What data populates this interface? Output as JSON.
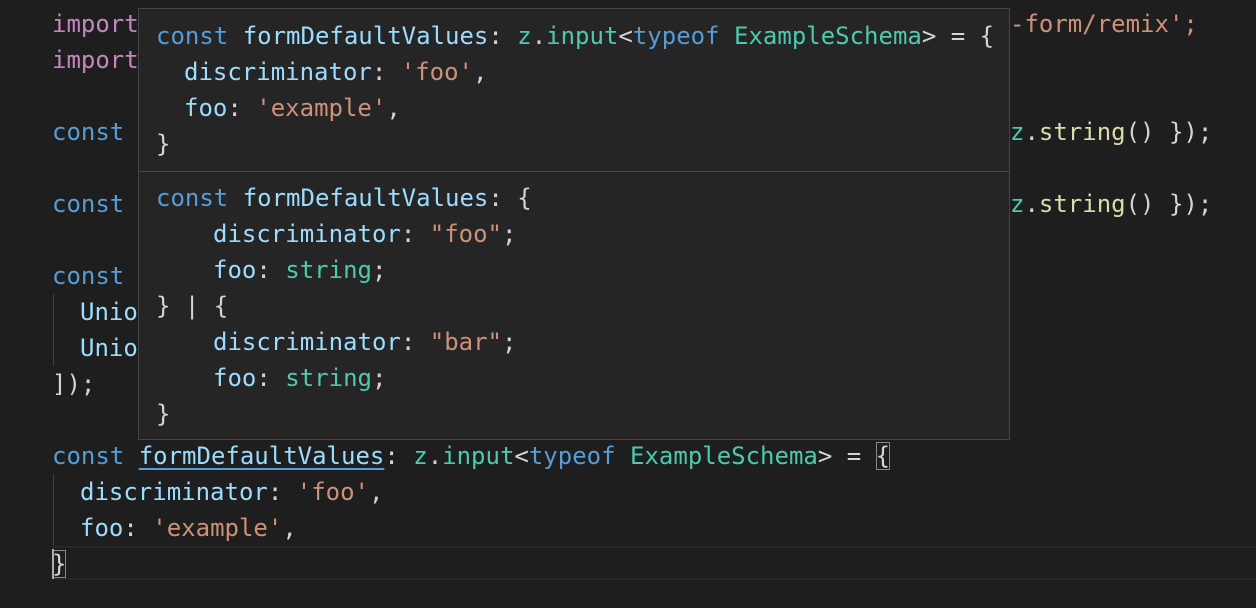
{
  "editor": {
    "lines": {
      "l1_a": "import",
      "l1_b": "-form/remix';",
      "l2_a": "import",
      "l3_a": "const",
      "l3_b": "z",
      "l3_c": ".",
      "l3_d": "string",
      "l3_e": "() });",
      "l4_a": "const",
      "l4_b": "z",
      "l4_c": ".",
      "l4_d": "string",
      "l4_e": "() });",
      "l5_a": "const",
      "l6_a": "Unio",
      "l7_a": "Unio",
      "l8_a": "]);",
      "l9_kw": "const",
      "l9_name": "formDefaultValues",
      "l9_colon": ": ",
      "l9_z": "z",
      "l9_dot": ".",
      "l9_input": "input",
      "l9_lt": "<",
      "l9_typeof": "typeof",
      "l9_schema": "ExampleSchema",
      "l9_gt": "> = ",
      "l9_brace": "{",
      "l10_key": "discriminator",
      "l10_colon": ": ",
      "l10_val": "'foo'",
      "l10_comma": ",",
      "l11_key": "foo",
      "l11_colon": ": ",
      "l11_val": "'example'",
      "l11_comma": ",",
      "l12_brace": "}"
    }
  },
  "hover": {
    "top": {
      "r1_kw": "const",
      "r1_name": "formDefaultValues",
      "r1_colon": ": ",
      "r1_z": "z",
      "r1_dot": ".",
      "r1_input": "input",
      "r1_lt": "<",
      "r1_typeof": "typeof",
      "r1_schema": "ExampleSchema",
      "r1_gt": "> = {",
      "r2_key": "discriminator",
      "r2_colon": ": ",
      "r2_val": "'foo'",
      "r2_comma": ",",
      "r3_key": "foo",
      "r3_colon": ": ",
      "r3_val": "'example'",
      "r3_comma": ",",
      "r4_brace": "}"
    },
    "bottom": {
      "r1_kw": "const",
      "r1_name": "formDefaultValues",
      "r1_rest": ": {",
      "r2_key": "discriminator",
      "r2_colon": ": ",
      "r2_val": "\"foo\"",
      "r2_semi": ";",
      "r3_key": "foo",
      "r3_colon": ": ",
      "r3_type": "string",
      "r3_semi": ";",
      "r4_text": "} | {",
      "r5_key": "discriminator",
      "r5_colon": ": ",
      "r5_val": "\"bar\"",
      "r5_semi": ";",
      "r6_key": "foo",
      "r6_colon": ": ",
      "r6_type": "string",
      "r6_semi": ";",
      "r7_brace": "}"
    }
  }
}
